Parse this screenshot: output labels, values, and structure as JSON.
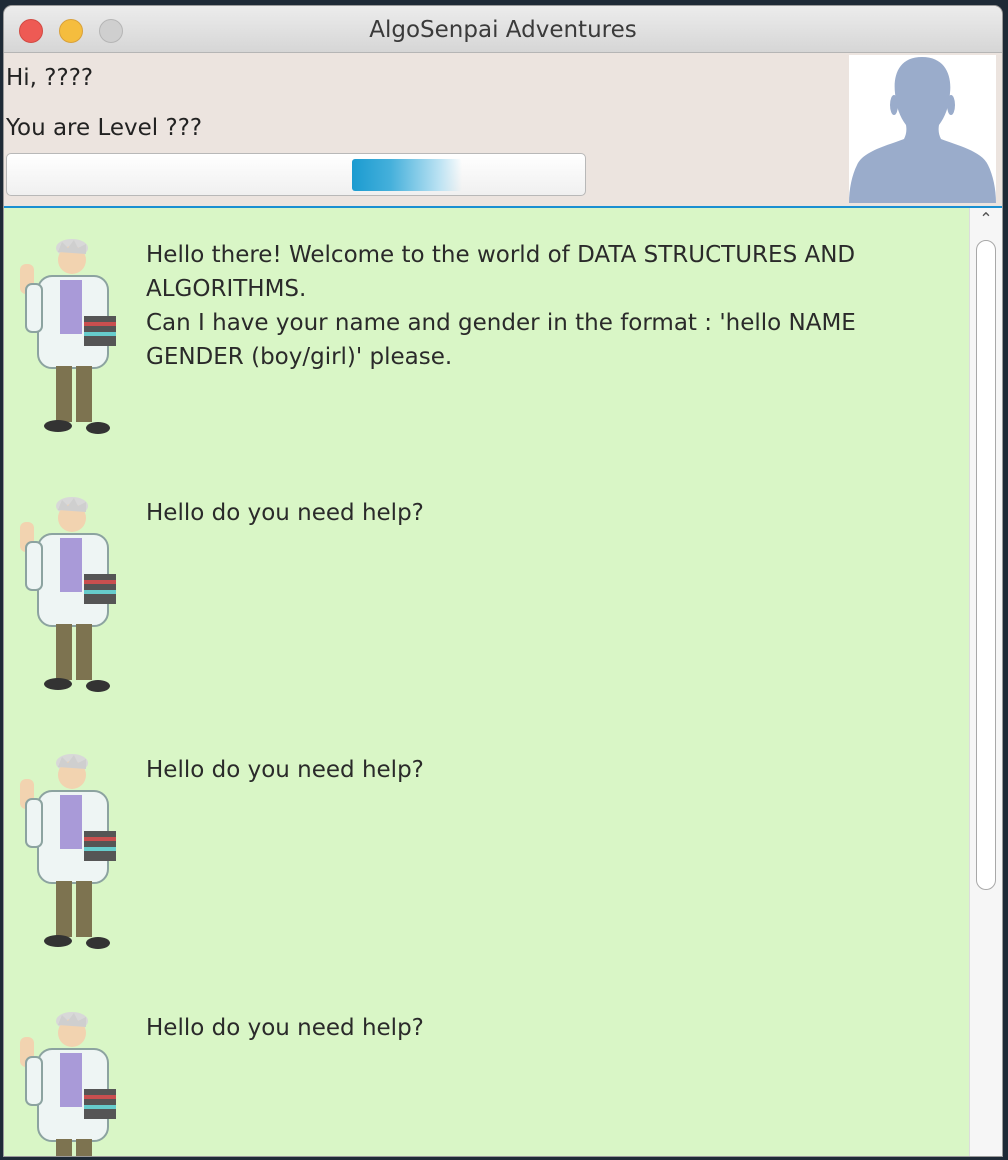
{
  "window": {
    "title": "AlgoSenpai Adventures"
  },
  "header": {
    "greeting": "Hi, ????",
    "level": "You are Level ???",
    "progress_fraction": 0.15
  },
  "icons": {
    "user_avatar": "user-silhouette-icon",
    "bot_avatar": "professor-icon",
    "scroll_up": "chevron-up-icon"
  },
  "colors": {
    "dialog_bg": "#d9f6c6",
    "accent": "#1a8fd1",
    "avatar_silhouette": "#9aaccb"
  },
  "messages": [
    {
      "text": "Hello there! Welcome to the world of DATA STRUCTURES AND\nALGORITHMS.\nCan I have your name and gender in the format : 'hello NAME\nGENDER (boy/girl)' please."
    },
    {
      "text": "Hello do you need help?"
    },
    {
      "text": "Hello do you need help?"
    },
    {
      "text": "Hello do you need help?"
    }
  ]
}
